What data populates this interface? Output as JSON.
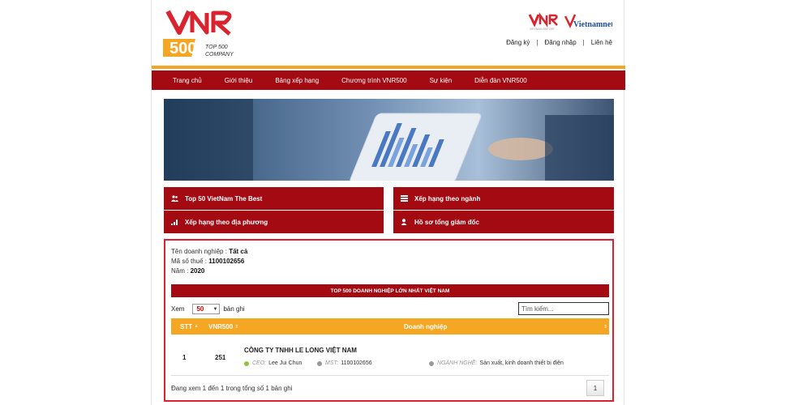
{
  "header": {
    "logo": {
      "mark": "VNR",
      "number": "500",
      "caption_line1": "TOP 500",
      "caption_line2": "COMPANY"
    },
    "partners": {
      "vnr_small": "VNR",
      "vnr_small_caption": "VIETNAM REPORT",
      "vietnamnet": "Vietnamnet"
    },
    "links": [
      "Đăng ký",
      "Đăng nhập",
      "Liên hệ"
    ]
  },
  "nav": [
    "Trang chủ",
    "Giới thiệu",
    "Bảng xếp hạng",
    "Chương trình VNR500",
    "Sự kiện",
    "Diễn đàn VNR500"
  ],
  "categories": [
    {
      "label": "Top 50 VietNam The Best",
      "icon": "people-icon"
    },
    {
      "label": "Xếp hạng theo ngành",
      "icon": "list-icon"
    },
    {
      "label": "Xếp hạng theo địa phương",
      "icon": "signal-icon"
    },
    {
      "label": "Hồ sơ tổng giám đốc",
      "icon": "user-icon"
    }
  ],
  "filters": {
    "company_label": "Tên doanh nghiệp :",
    "company_value": "Tất cả",
    "tax_label": "Mã số thuế :",
    "tax_value": "1100102656",
    "year_label": "Năm :",
    "year_value": "2020"
  },
  "table_title": "TOP 500 DOANH NGHIỆP LỚN NHẤT VIỆT NAM",
  "length": {
    "before": "Xem",
    "value": "50",
    "after": "bản ghi"
  },
  "search": {
    "placeholder": "Tìm kiếm..."
  },
  "columns": [
    "STT",
    "VNR500",
    "Doanh nghiệp"
  ],
  "rows": [
    {
      "stt": "1",
      "rank": "251",
      "name": "CÔNG TY TNHH LE LONG VIỆT NAM",
      "ceo_label": "CEO:",
      "ceo": "Lee Jui Chun",
      "mst_label": "MST:",
      "mst": "1100102656",
      "industry_label": "NGÀNH NGHỀ:",
      "industry": "Sản xuất, kinh doanh thiết bị điện"
    }
  ],
  "footer": {
    "info": "Đang xem 1 đến 1 trong tổng số 1 bản ghi",
    "page": "1"
  },
  "colors": {
    "brand_red": "#a30a12",
    "gold": "#f5a623",
    "border_red": "#d9242f",
    "ceo_dot": "#8cc63f",
    "grey_dot": "#999999"
  }
}
